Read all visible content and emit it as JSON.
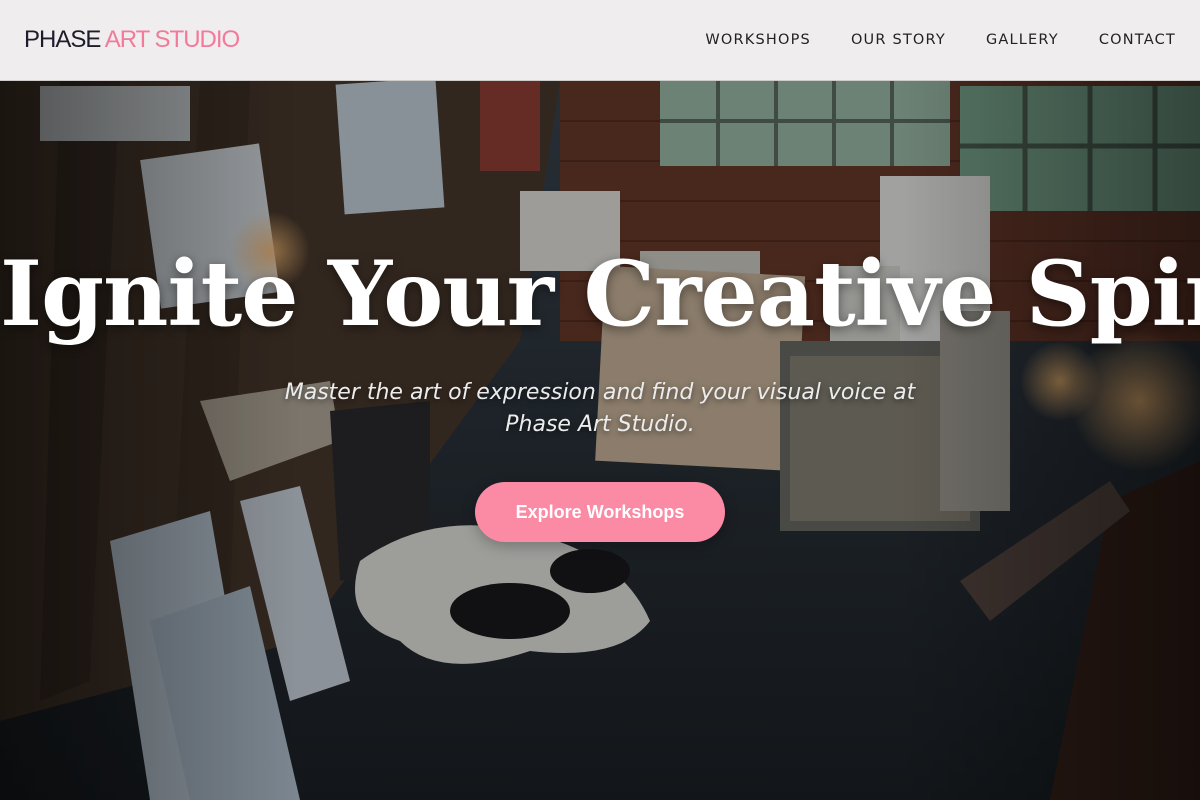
{
  "brand": {
    "name_part1": "PHASE",
    "name_part2": "ART STUDIO"
  },
  "nav": [
    {
      "label": "WORKSHOPS"
    },
    {
      "label": "OUR STORY"
    },
    {
      "label": "GALLERY"
    },
    {
      "label": "CONTACT"
    }
  ],
  "hero": {
    "title": "Ignite Your Creative Spirit",
    "subtitle": "Master the art of expression and find your visual voice at Phase Art Studio.",
    "cta_label": "Explore Workshops",
    "background_icon": "art-studio-photo-icon"
  },
  "colors": {
    "accent": "#fb8aa4",
    "logo_accent": "#f27a9a",
    "logo_dark": "#1d1d2b",
    "header_bg": "#efeded"
  }
}
